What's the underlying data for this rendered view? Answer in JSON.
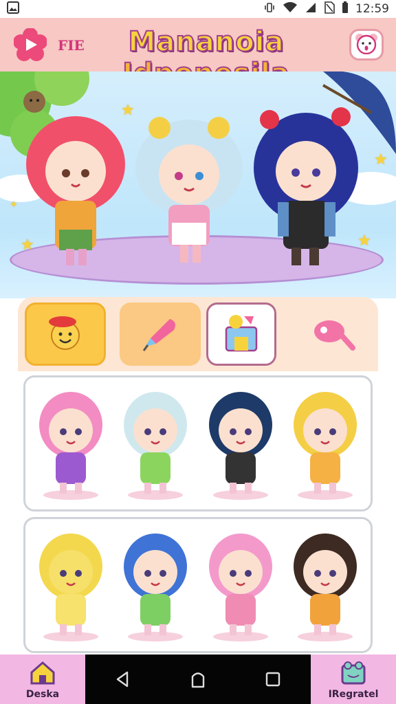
{
  "status_bar": {
    "time": "12:59",
    "icons": [
      "gallery-icon",
      "vibrate-icon",
      "wifi-icon",
      "signal-icon",
      "no-sim-icon",
      "battery-icon"
    ]
  },
  "header": {
    "badge": "FIE",
    "title_line1": "Mananoia",
    "title_line2": "Idponesila",
    "logo_icon": "play-flower-icon",
    "profile_icon": "bear-face-icon"
  },
  "tabs": [
    {
      "icon": "smiley-hat-icon"
    },
    {
      "icon": "brush-icon"
    },
    {
      "icon": "wardrobe-icon"
    },
    {
      "icon": "candy-icon"
    }
  ],
  "characters": {
    "row1": [
      {
        "hair": "#f38cc2",
        "outfit": "#9c5ad0",
        "skin": "#fbe0cf"
      },
      {
        "hair": "#cfe8ee",
        "outfit": "#8bd55e",
        "skin": "#fbe0cf"
      },
      {
        "hair": "#1e3a68",
        "outfit": "#333333",
        "skin": "#fbe0cf"
      },
      {
        "hair": "#f4cf45",
        "outfit": "#f5b143",
        "skin": "#fbe0cf"
      }
    ],
    "row2": [
      {
        "hair": "#f3d84e",
        "outfit": "#f6e26c",
        "skin": "#f6e06a"
      },
      {
        "hair": "#3f73d6",
        "outfit": "#7ecf63",
        "skin": "#fbe0cf"
      },
      {
        "hair": "#f39acb",
        "outfit": "#f08bb3",
        "skin": "#fbe0cf"
      },
      {
        "hair": "#3d2a22",
        "outfit": "#f2a23a",
        "skin": "#fbe0cf"
      }
    ]
  },
  "hero_characters": [
    {
      "hair": "#f1506a",
      "outfit": "#f0a53b"
    },
    {
      "hair": "#c8e4f3",
      "outfit": "#f29ec0"
    },
    {
      "hair": "#28339a",
      "outfit": "#2b2b2b"
    }
  ],
  "bottom_nav": {
    "left_label": "Deska",
    "right_label": "IRegratel",
    "left_icon": "house-icon",
    "right_icon": "frog-card-icon"
  },
  "colors": {
    "header_bg": "#f7c8c4",
    "panel_bg": "#fde6d4",
    "accent": "#fcc84a",
    "bottom_nav_bg": "#f2b7e3"
  }
}
